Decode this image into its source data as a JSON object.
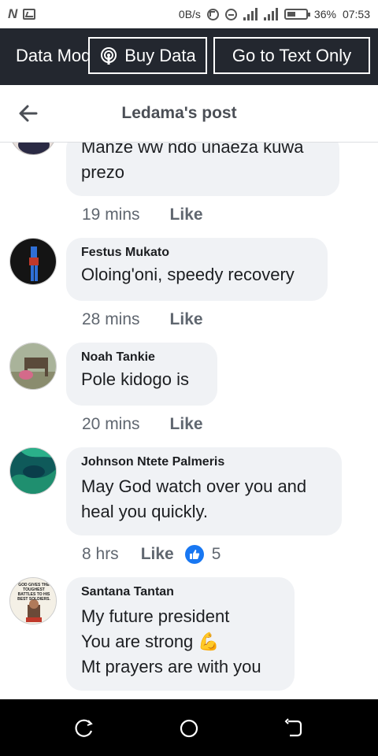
{
  "status_bar": {
    "speed": "0B/s",
    "battery": "36%",
    "time": "07:53",
    "icons": [
      "n-icon",
      "gallery-icon",
      "sync-icon",
      "dnd-icon",
      "signal-icon",
      "battery-icon"
    ]
  },
  "data_bar": {
    "mode_label": "Data Mode",
    "buy_data": "Buy Data",
    "text_only": "Go to Text Only"
  },
  "header": {
    "title": "Ledama's post"
  },
  "comments": [
    {
      "author": "",
      "text": "Manze ww ndo unaeza kuwa prezo",
      "time": "19 mins",
      "like": "Like"
    },
    {
      "author": "Festus Mukato",
      "text": "Oloing'oni, speedy recovery",
      "time": "28 mins",
      "like": "Like"
    },
    {
      "author": "Noah Tankie",
      "text": "Pole kidogo is",
      "time": "20 mins",
      "like": "Like"
    },
    {
      "author": "Johnson Ntete Palmeris",
      "text": "May God watch over you and heal you quickly.",
      "time": "8 hrs",
      "like": "Like",
      "reaction_count": "5"
    },
    {
      "author": "Santana Tantan",
      "text": "My future president\nYou are strong 💪\nMt prayers are with you",
      "avatar_caption": "GOD GIVES THE TOUGHEST BATTLES TO HIS BEST SOLDIERS."
    }
  ],
  "colors": {
    "data_bar": "#23272f",
    "bubble": "#f0f2f5",
    "like_blue": "#1877f2",
    "meta_gray": "#606770"
  }
}
